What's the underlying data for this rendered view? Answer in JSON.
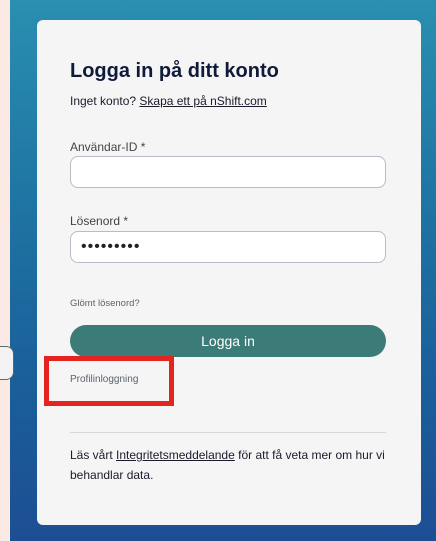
{
  "login": {
    "title": "Logga in på ditt konto",
    "subtitle_prefix": "Inget konto? ",
    "signup_link": "Skapa ett på nShift.com",
    "user_id_label": "Användar-ID",
    "user_id_value": "",
    "password_label": "Lösenord",
    "password_value": "•••••••••",
    "required_marker": "*",
    "forgot_password": "Glömt lösenord?",
    "login_button": "Logga in",
    "profile_login": "Profilinloggning"
  },
  "privacy": {
    "prefix": "Läs vårt ",
    "link": "Integritetsmeddelande",
    "suffix": " för att få veta mer om hur vi behandlar data."
  },
  "colors": {
    "button": "#3b7b78",
    "highlight": "#e42421",
    "background_top": "#2a8fb0",
    "background_bottom": "#1d4e93"
  }
}
